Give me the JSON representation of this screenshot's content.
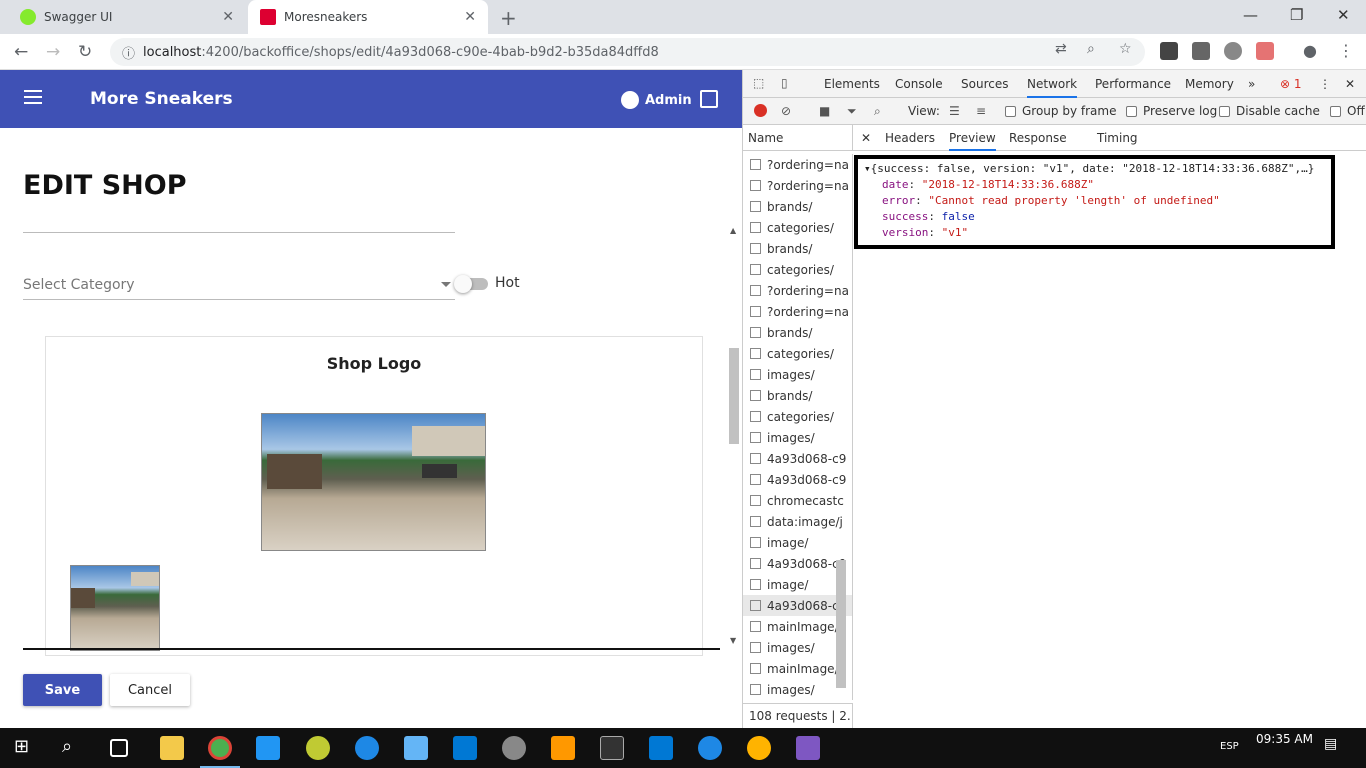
{
  "browser": {
    "tabs": [
      {
        "title": "Swagger UI",
        "favicon_color": "#85ea2d"
      },
      {
        "title": "Moresneakers",
        "favicon_color": "#dd0031"
      }
    ],
    "url_host": "localhost",
    "url_path": ":4200/backoffice/shops/edit/4a93d068-c90e-4bab-b9d2-b35da84dffd8"
  },
  "app": {
    "title": "More Sneakers",
    "user": "Admin",
    "page_title": "EDIT SHOP",
    "category_placeholder": "Select Category",
    "hot_label": "Hot",
    "hot_enabled": false,
    "logo_section_title": "Shop Logo",
    "save_label": "Save",
    "cancel_label": "Cancel",
    "primary_color": "#3f51b5"
  },
  "devtools": {
    "tabs": [
      "Elements",
      "Console",
      "Sources",
      "Network",
      "Performance",
      "Memory"
    ],
    "active_tab": "Network",
    "error_count": "1",
    "view_label": "View:",
    "group_by_frame": "Group by frame",
    "preserve_log": "Preserve log",
    "disable_cache": "Disable cache",
    "offline": "Off",
    "name_header": "Name",
    "detail_tabs": [
      "Headers",
      "Preview",
      "Response",
      "Timing"
    ],
    "active_detail_tab": "Preview",
    "requests": [
      "?ordering=na",
      "?ordering=na",
      "brands/",
      "categories/",
      "brands/",
      "categories/",
      "?ordering=na",
      "?ordering=na",
      "brands/",
      "categories/",
      "images/",
      "brands/",
      "categories/",
      "images/",
      "4a93d068-c9",
      "4a93d068-c9",
      "chromecastc",
      "data:image/j",
      "image/",
      "4a93d068-c9",
      "image/",
      "4a93d068-c9",
      "mainImage/",
      "images/",
      "mainImage/",
      "images/"
    ],
    "selected_request_index": 21,
    "status": "108 requests  |  2...",
    "preview": {
      "summary": "{success: false, version: \"v1\", date: \"2018-12-18T14:33:36.688Z\",…}",
      "props": [
        {
          "key": "date",
          "value": "\"2018-12-18T14:33:36.688Z\"",
          "kind": "str"
        },
        {
          "key": "error",
          "value": "\"Cannot read property 'length' of undefined\"",
          "kind": "str"
        },
        {
          "key": "success",
          "value": "false",
          "kind": "kw"
        },
        {
          "key": "version",
          "value": "\"v1\"",
          "kind": "str"
        }
      ]
    }
  },
  "taskbar": {
    "time": "09:35 AM",
    "lang": "ESP"
  }
}
